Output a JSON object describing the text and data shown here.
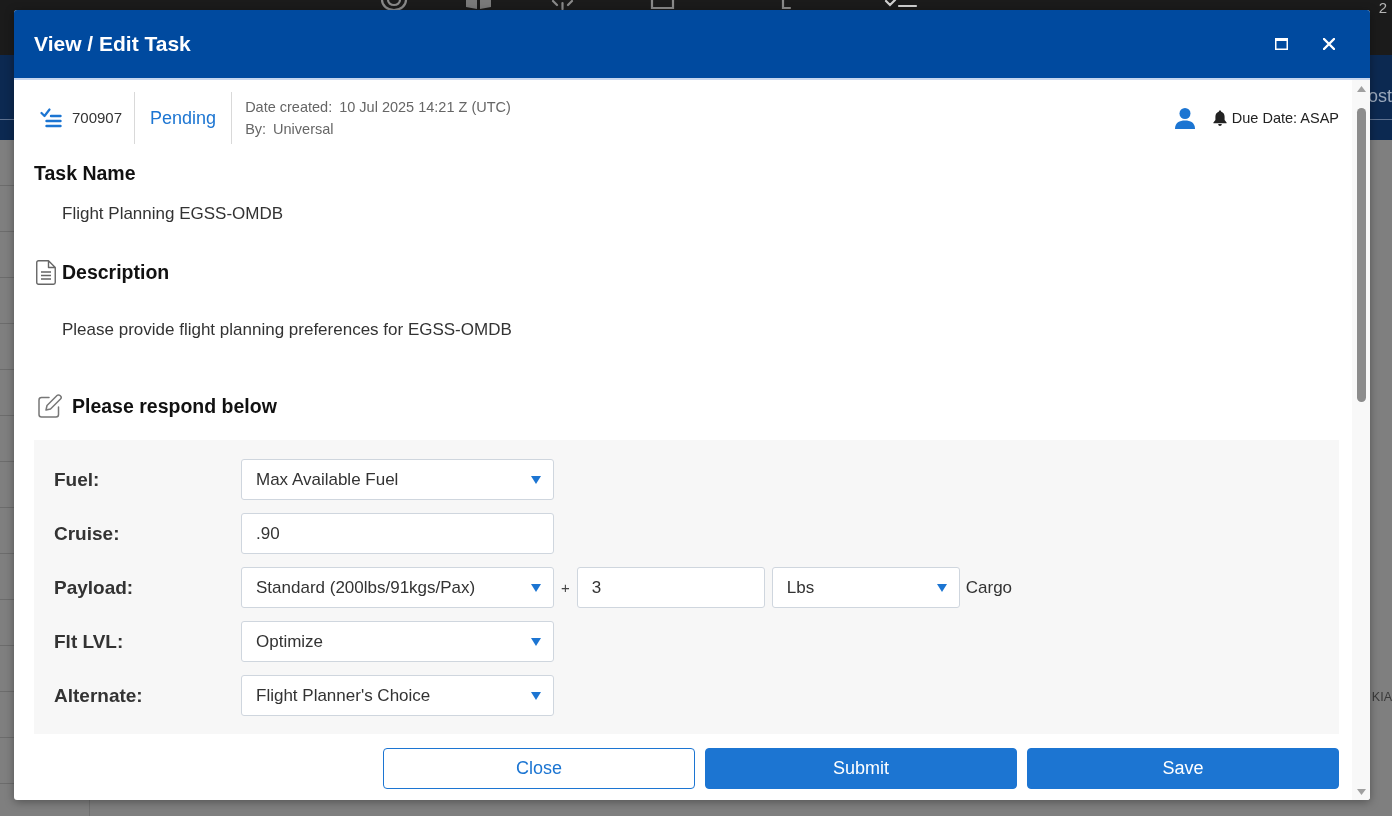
{
  "backdrop": {
    "corner_text": "2",
    "header_text": "ost",
    "row_text": "KIA"
  },
  "dialog": {
    "title": "View / Edit Task"
  },
  "task": {
    "id": "700907",
    "status": "Pending",
    "date_created_label": "Date created:",
    "date_created": "10 Jul 2025 14:21 Z (UTC)",
    "by_label": "By:",
    "by": "Universal",
    "due_date": "Due Date: ASAP"
  },
  "task_name": {
    "heading": "Task Name",
    "value": "Flight Planning EGSS-OMDB"
  },
  "description": {
    "heading": "Description",
    "text": "Please provide flight planning preferences for EGSS-OMDB"
  },
  "response": {
    "heading": "Please respond below",
    "rows": [
      {
        "label": "Fuel:",
        "fields": [
          {
            "kind": "select",
            "value": "Max Available Fuel"
          }
        ]
      },
      {
        "label": "Cruise:",
        "fields": [
          {
            "kind": "input",
            "value": ".90"
          }
        ]
      },
      {
        "label": "Payload:",
        "fields": [
          {
            "kind": "select",
            "value": "Standard (200lbs/91kgs/Pax)"
          },
          {
            "kind": "separator",
            "value": "+"
          },
          {
            "kind": "input",
            "value": "3"
          },
          {
            "kind": "select",
            "value": "Lbs"
          },
          {
            "kind": "suffix",
            "value": "Cargo"
          }
        ]
      },
      {
        "label": "Flt LVL:",
        "fields": [
          {
            "kind": "select",
            "value": "Optimize"
          }
        ]
      },
      {
        "label": "Alternate:",
        "fields": [
          {
            "kind": "select",
            "value": "Flight Planner's Choice"
          }
        ]
      }
    ]
  },
  "buttons": [
    {
      "label": "Close",
      "kind": "outline"
    },
    {
      "label": "Submit",
      "kind": "primary"
    },
    {
      "label": "Save",
      "kind": "primary"
    }
  ]
}
